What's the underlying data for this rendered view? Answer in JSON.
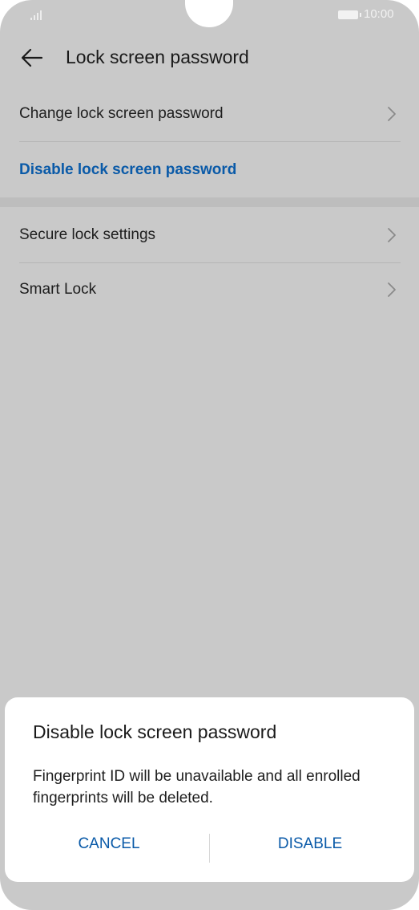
{
  "status_bar": {
    "time": "10:00"
  },
  "header": {
    "title": "Lock screen password"
  },
  "list": {
    "change_password": "Change lock screen password",
    "disable_password": "Disable lock screen password",
    "secure_lock": "Secure lock settings",
    "smart_lock": "Smart Lock"
  },
  "dialog": {
    "title": "Disable lock screen password",
    "message": "Fingerprint ID will be unavailable and all enrolled fingerprints will be deleted.",
    "cancel_label": "CANCEL",
    "disable_label": "DISABLE"
  },
  "colors": {
    "accent": "#0a5aa8",
    "dim_background": "#c9c9c9"
  },
  "icons": {
    "back": "arrow-left-icon",
    "chevron": "chevron-right-icon",
    "signal": "signal-icon",
    "battery": "battery-icon"
  }
}
